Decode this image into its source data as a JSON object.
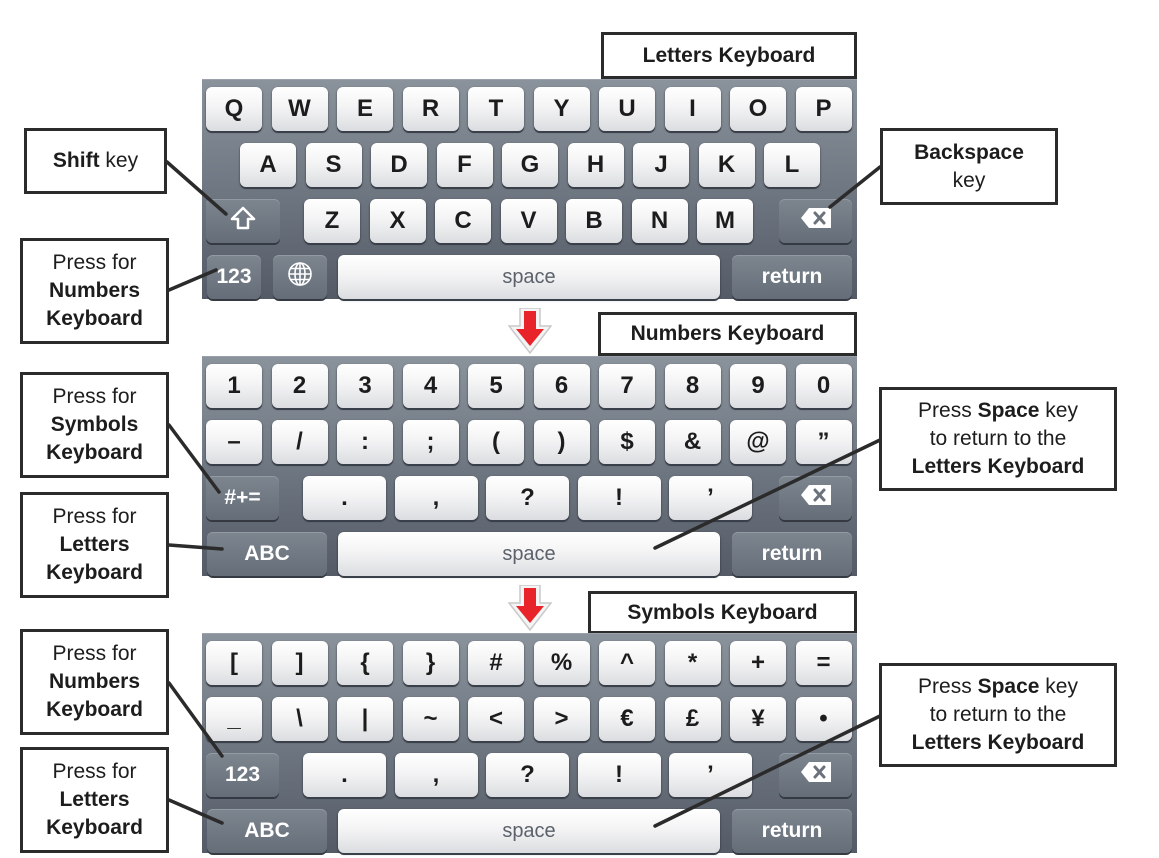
{
  "keyboards": [
    {
      "title": "Letters Keyboard",
      "rows": [
        [
          "Q",
          "W",
          "E",
          "R",
          "T",
          "Y",
          "U",
          "I",
          "O",
          "P"
        ],
        [
          "A",
          "S",
          "D",
          "F",
          "G",
          "H",
          "J",
          "K",
          "L"
        ],
        [
          "Z",
          "X",
          "C",
          "V",
          "B",
          "N",
          "M"
        ]
      ],
      "mode_key": "123",
      "globe_icon": "globe-icon",
      "shift_icon": "shift-arrow-icon",
      "backspace_icon": "backspace-icon",
      "space": "space",
      "return": "return"
    },
    {
      "title": "Numbers Keyboard",
      "rows": [
        [
          "1",
          "2",
          "3",
          "4",
          "5",
          "6",
          "7",
          "8",
          "9",
          "0"
        ],
        [
          "–",
          "/",
          ":",
          ";",
          "(",
          ")",
          "$",
          "&",
          "@",
          "”"
        ],
        [
          ".",
          ",",
          "?",
          "!",
          "’"
        ]
      ],
      "switch_key": "#+=",
      "mode_key": "ABC",
      "backspace_icon": "backspace-icon",
      "space": "space",
      "return": "return"
    },
    {
      "title": "Symbols Keyboard",
      "rows": [
        [
          "[",
          "]",
          "{",
          "}",
          "#",
          "%",
          "^",
          "*",
          "+",
          "="
        ],
        [
          "_",
          "\\",
          "|",
          "~",
          "<",
          ">",
          "€",
          "£",
          "¥",
          "•"
        ],
        [
          ".",
          ",",
          "?",
          "!",
          "’"
        ]
      ],
      "switch_key": "123",
      "mode_key": "ABC",
      "backspace_icon": "backspace-icon",
      "space": "space",
      "return": "return"
    }
  ],
  "callouts": {
    "shift": {
      "bold": "Shift",
      "rest": " key"
    },
    "backspace": {
      "line1": "Backspace",
      "line2": "key"
    },
    "numbers_1": {
      "line1": "Press for",
      "line2": "Numbers",
      "line3": "Keyboard"
    },
    "symbols": {
      "line1": "Press for",
      "line2": "Symbols",
      "line3": "Keyboard"
    },
    "letters_2": {
      "line1": "Press for",
      "line2": "Letters",
      "line3": "Keyboard"
    },
    "numbers_3": {
      "line1": "Press for",
      "line2": "Numbers",
      "line3": "Keyboard"
    },
    "letters_3": {
      "line1": "Press for",
      "line2": "Letters",
      "line3": "Keyboard"
    },
    "space_2": {
      "pre": "Press ",
      "bold": "Space",
      "post": " key",
      "line2": "to return to the",
      "line3": "Letters Keyboard"
    },
    "space_3": {
      "pre": "Press ",
      "bold": "Space",
      "post": " key",
      "line2": "to return to the",
      "line3": "Letters Keyboard"
    }
  },
  "colors": {
    "arrow": "#e8232a",
    "keyboard_bg": "#6c747f",
    "callout_border": "#2b2b2b"
  }
}
